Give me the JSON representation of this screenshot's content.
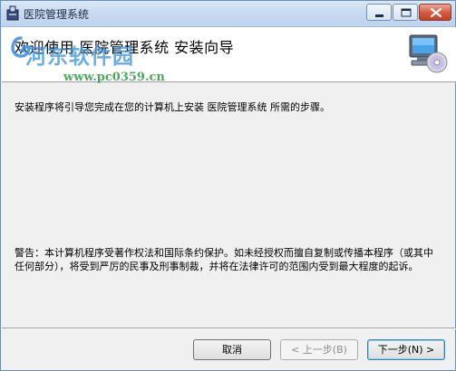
{
  "window": {
    "title": "医院管理系统"
  },
  "header": {
    "title": "欢迎使用 医院管理系统 安装向导"
  },
  "watermark": {
    "site_name": "河东软件园",
    "url": "www.pc0359.cn"
  },
  "body": {
    "intro": "安装程序将引导您完成在您的计算机上安装 医院管理系统 所需的步骤。",
    "warning": "警告：本计算机程序受著作权法和国际条约保护。如未经授权而擅自复制或传播本程序（或其中任何部分），将受到严厉的民事及刑事制裁，并将在法律许可的范围内受到最大程度的起诉。"
  },
  "buttons": {
    "cancel": "取消",
    "back": "< 上一步(B)",
    "next": "下一步(N) >"
  },
  "icons": {
    "app": "installer-icon",
    "header": "computer-cd-icon"
  }
}
